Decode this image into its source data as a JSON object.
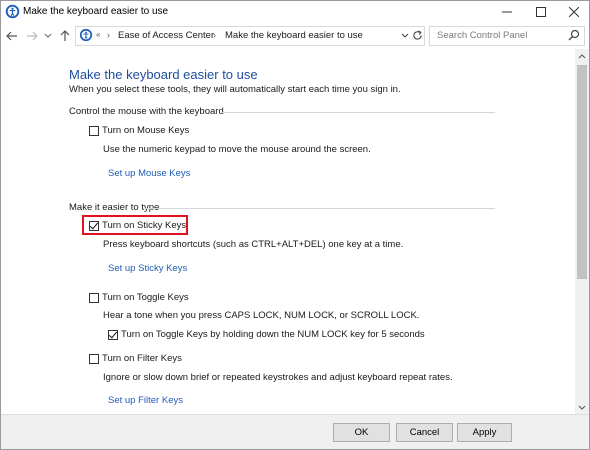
{
  "window": {
    "title": "Make the keyboard easier to use",
    "controls": {
      "minimize_icon": "minimize-icon",
      "maximize_icon": "maximize-icon",
      "close_icon": "close-icon"
    }
  },
  "navigation": {
    "breadcrumb": [
      "Ease of Access Center",
      "Make the keyboard easier to use"
    ],
    "overflow": "«",
    "search_placeholder": "Search Control Panel"
  },
  "page": {
    "title": "Make the keyboard easier to use",
    "subtitle": "When you select these tools, they will automatically start each time you sign in."
  },
  "mouse_section": {
    "heading": "Control the mouse with the keyboard",
    "mouse_keys": {
      "label": "Turn on Mouse Keys",
      "checked": false
    },
    "mouse_keys_desc": "Use the numeric keypad to move the mouse around the screen.",
    "mouse_keys_link": "Set up Mouse Keys"
  },
  "typing_section": {
    "heading": "Make it easier to type",
    "sticky_keys": {
      "label": "Turn on Sticky Keys",
      "checked": true
    },
    "sticky_keys_desc": "Press keyboard shortcuts (such as CTRL+ALT+DEL) one key at a time.",
    "sticky_keys_link": "Set up Sticky Keys",
    "toggle_keys": {
      "label": "Turn on Toggle Keys",
      "checked": false
    },
    "toggle_keys_desc": "Hear a tone when you press CAPS LOCK, NUM LOCK, or SCROLL LOCK.",
    "toggle_keys_hold": {
      "label": "Turn on Toggle Keys by holding down the NUM LOCK key for 5 seconds",
      "checked": true
    },
    "filter_keys": {
      "label": "Turn on Filter Keys",
      "checked": false
    },
    "filter_keys_desc": "Ignore or slow down brief or repeated keystrokes and adjust keyboard repeat rates.",
    "filter_keys_link": "Set up Filter Keys"
  },
  "buttons": {
    "ok": "OK",
    "cancel": "Cancel",
    "apply": "Apply"
  },
  "colors": {
    "title_blue": "#1f4e9e",
    "link_blue": "#1f5db8",
    "highlight_red": "#e0121f"
  }
}
